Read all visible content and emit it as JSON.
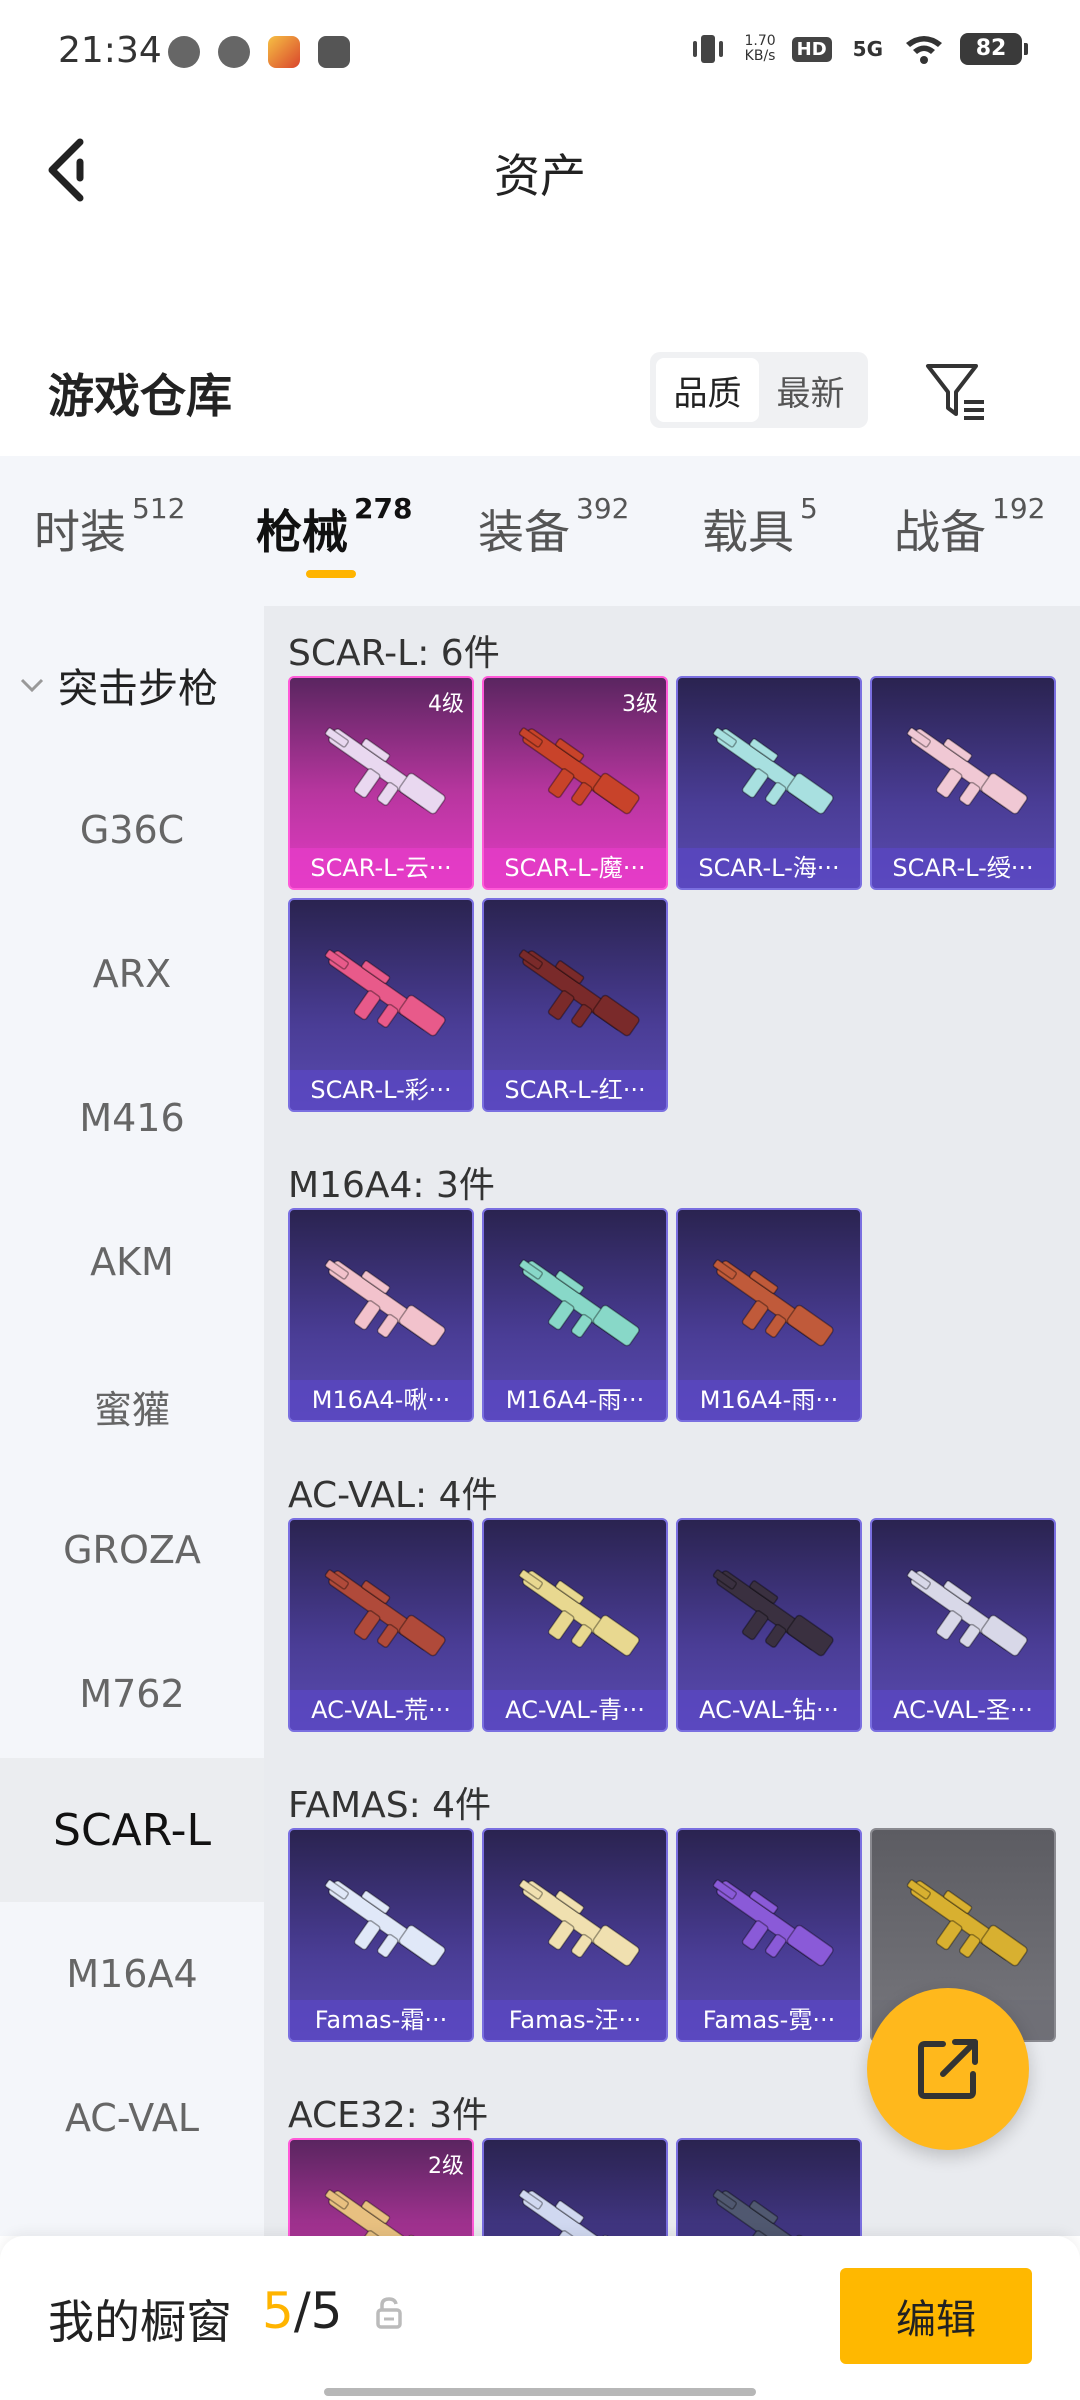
{
  "status": {
    "time": "21:34",
    "net_speed_value": "1.70",
    "net_speed_unit": "KB/s",
    "hd": "HD",
    "network": "5G",
    "battery": "82"
  },
  "nav": {
    "title": "资产"
  },
  "warehouse": {
    "title": "游戏仓库",
    "sort_options": [
      "品质",
      "最新"
    ],
    "sort_active": "品质"
  },
  "tabs": [
    {
      "label": "时装",
      "count": "512"
    },
    {
      "label": "枪械",
      "count": "278"
    },
    {
      "label": "装备",
      "count": "392"
    },
    {
      "label": "载具",
      "count": "5"
    },
    {
      "label": "战备",
      "count": "192"
    }
  ],
  "sidebar": {
    "group": "突击步枪",
    "items": [
      "G36C",
      "ARX",
      "M416",
      "AKM",
      "蜜獾",
      "GROZA",
      "M762",
      "SCAR-L",
      "M16A4",
      "AC-VAL"
    ],
    "active": "SCAR-L"
  },
  "sections": [
    {
      "title": "SCAR-L: 6件",
      "items": [
        {
          "label": "SCAR-L-云···",
          "level": "4级",
          "style": "pink",
          "gun_color": "#e9d8f0"
        },
        {
          "label": "SCAR-L-魔···",
          "level": "3级",
          "style": "pink",
          "gun_color": "#c8432a"
        },
        {
          "label": "SCAR-L-海···",
          "level": "",
          "style": "purple",
          "gun_color": "#a8e0e0"
        },
        {
          "label": "SCAR-L-绶···",
          "level": "",
          "style": "purple",
          "gun_color": "#f0c8d4"
        },
        {
          "label": "SCAR-L-彩···",
          "level": "",
          "style": "purple",
          "gun_color": "#e85a8a"
        },
        {
          "label": "SCAR-L-红···",
          "level": "",
          "style": "purple",
          "gun_color": "#7a2a2a"
        }
      ]
    },
    {
      "title": "M16A4: 3件",
      "items": [
        {
          "label": "M16A4-啾···",
          "level": "",
          "style": "purple",
          "gun_color": "#f2c2cc"
        },
        {
          "label": "M16A4-雨···",
          "level": "",
          "style": "purple",
          "gun_color": "#88d8c8"
        },
        {
          "label": "M16A4-雨···",
          "level": "",
          "style": "purple",
          "gun_color": "#c05a3a"
        }
      ]
    },
    {
      "title": "AC-VAL: 4件",
      "items": [
        {
          "label": "AC-VAL-荒···",
          "level": "",
          "style": "purple",
          "gun_color": "#b04a3a"
        },
        {
          "label": "AC-VAL-青···",
          "level": "",
          "style": "purple",
          "gun_color": "#e8d890"
        },
        {
          "label": "AC-VAL-钻···",
          "level": "",
          "style": "purple",
          "gun_color": "#3a3040"
        },
        {
          "label": "AC-VAL-圣···",
          "level": "",
          "style": "purple",
          "gun_color": "#d8d8e8"
        }
      ]
    },
    {
      "title": "FAMAS: 4件",
      "items": [
        {
          "label": "Famas-霜···",
          "level": "",
          "style": "purple",
          "gun_color": "#e0e8f8"
        },
        {
          "label": "Famas-汪···",
          "level": "",
          "style": "purple",
          "gun_color": "#f0e0b0"
        },
        {
          "label": "Famas-霓···",
          "level": "",
          "style": "purple",
          "gun_color": "#8a5ad8"
        },
        {
          "label": "",
          "level": "",
          "style": "gray",
          "gun_color": "#d8b030"
        }
      ]
    },
    {
      "title": "ACE32: 3件",
      "items": [
        {
          "label": "",
          "level": "2级",
          "style": "pink",
          "gun_color": "#e8c080"
        },
        {
          "label": "",
          "level": "",
          "style": "purple",
          "gun_color": "#d0d8f0"
        },
        {
          "label": "",
          "level": "",
          "style": "purple",
          "gun_color": "#505870"
        }
      ]
    }
  ],
  "showcase": {
    "label": "我的橱窗",
    "current": "5",
    "total": "/5"
  },
  "edit_label": "编辑"
}
